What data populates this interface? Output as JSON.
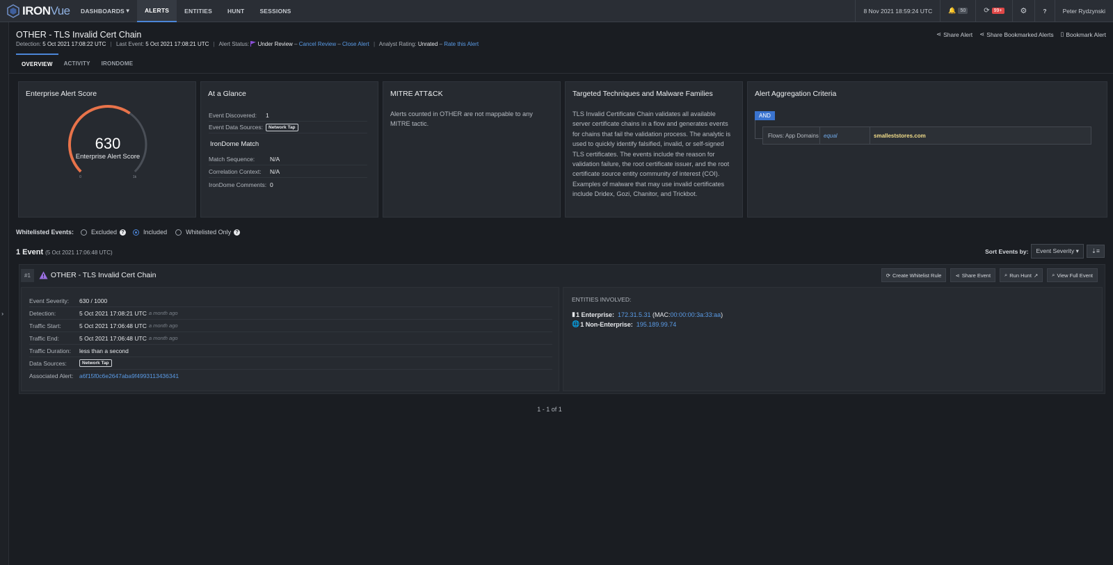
{
  "app": {
    "logo_a": "IRON",
    "logo_b": "Vue"
  },
  "nav": {
    "items": [
      "DASHBOARDS",
      "ALERTS",
      "ENTITIES",
      "HUNT",
      "SESSIONS"
    ],
    "datetime": "8 Nov 2021 18:59:24 UTC",
    "notif_count": "50",
    "sync_count": "99+",
    "user": "Peter Rydzynski"
  },
  "alert": {
    "title": "OTHER - TLS Invalid Cert Chain",
    "detection_label": "Detection:",
    "detection": "5 Oct 2021 17:08:22 UTC",
    "last_event_label": "Last Event:",
    "last_event": "5 Oct 2021 17:08:21 UTC",
    "status_label": "Alert Status:",
    "status": "Under Review",
    "cancel_review": "Cancel Review",
    "close_alert": "Close Alert",
    "rating_label": "Analyst Rating:",
    "rating": "Unrated",
    "rate": "Rate this Alert"
  },
  "header_actions": {
    "share_alert": "Share Alert",
    "share_bookmarked": "Share Bookmarked Alerts",
    "bookmark": "Bookmark Alert"
  },
  "tabs": [
    "OVERVIEW",
    "ACTIVITY",
    "IRONDOME"
  ],
  "score": {
    "title": "Enterprise Alert Score",
    "value": "630",
    "label": "Enterprise Alert Score",
    "min": "0",
    "max": "1k",
    "fraction": 0.63
  },
  "glance": {
    "title": "At a Glance",
    "event_discovered_label": "Event Discovered:",
    "event_discovered": "1",
    "sources_label": "Event Data Sources:",
    "source": "Network Tap",
    "irondome_title": "IronDome Match",
    "match_seq_label": "Match Sequence:",
    "match_seq": "N/A",
    "corr_label": "Correlation Context:",
    "corr": "N/A",
    "comments_label": "IronDome Comments:",
    "comments": "0"
  },
  "mitre": {
    "title": "MITRE ATT&CK",
    "text": "Alerts counted in OTHER are not mappable to any MITRE tactic."
  },
  "techniques": {
    "title": "Targeted Techniques and Malware Families",
    "text": "TLS Invalid Certificate Chain validates all available server certificate chains in a flow and generates events for chains that fail the validation process. The analytic is used to quickly identify falsified, invalid, or self-signed TLS certificates. The events include the reason for validation failure, the root certificate issuer, and the root certificate source entity community of interest (COI). Examples of malware that may use invalid certificates include Dridex, Gozi, Chanitor, and Trickbot."
  },
  "aggregation": {
    "title": "Alert Aggregation Criteria",
    "op": "AND",
    "field": "Flows: App Domains",
    "cmp": "equal",
    "value": "smalleststores.com"
  },
  "whitelist": {
    "label": "Whitelisted Events:",
    "excluded": "Excluded",
    "included": "Included",
    "only": "Whitelisted Only"
  },
  "events_header": {
    "count": "1 Event",
    "time": "(5 Oct 2021 17:06:48 UTC)",
    "sort_label": "Sort Events by:",
    "sort_value": "Event Severity"
  },
  "event": {
    "num": "#1",
    "title": "OTHER - TLS Invalid Cert Chain",
    "actions": [
      "Create Whitelist Rule",
      "Share Event",
      "Run Hunt",
      "View Full Event"
    ],
    "severity_label": "Event Severity:",
    "severity": "630 / 1000",
    "detection_label": "Detection:",
    "detection": "5 Oct 2021 17:08:21 UTC",
    "start_label": "Traffic Start:",
    "start": "5 Oct 2021 17:06:48 UTC",
    "end_label": "Traffic End:",
    "end": "5 Oct 2021 17:06:48 UTC",
    "ago": "a month ago",
    "duration_label": "Traffic Duration:",
    "duration": "less than a second",
    "sources_label": "Data Sources:",
    "source": "Network Tap",
    "assoc_label": "Associated Alert:",
    "assoc": "a6f15f0c6e2647aba9f4993113436341",
    "entities_label": "ENTITIES INVOLVED:",
    "ent1_label": "1 Enterprise:",
    "ent1_ip": "172.31.5.31",
    "ent1_mac_pre": "(MAC: ",
    "ent1_mac": "00:00:00:3a:33:aa",
    "ent1_mac_post": ")",
    "ent2_label": "1 Non-Enterprise:",
    "ent2_ip": "195.189.99.74"
  },
  "pager": "1 - 1 of 1",
  "colors": {
    "accent": "#4c86d8",
    "gauge": "#e8734a",
    "flag": "#8a4fd8",
    "highlight": "#f3de8a"
  }
}
